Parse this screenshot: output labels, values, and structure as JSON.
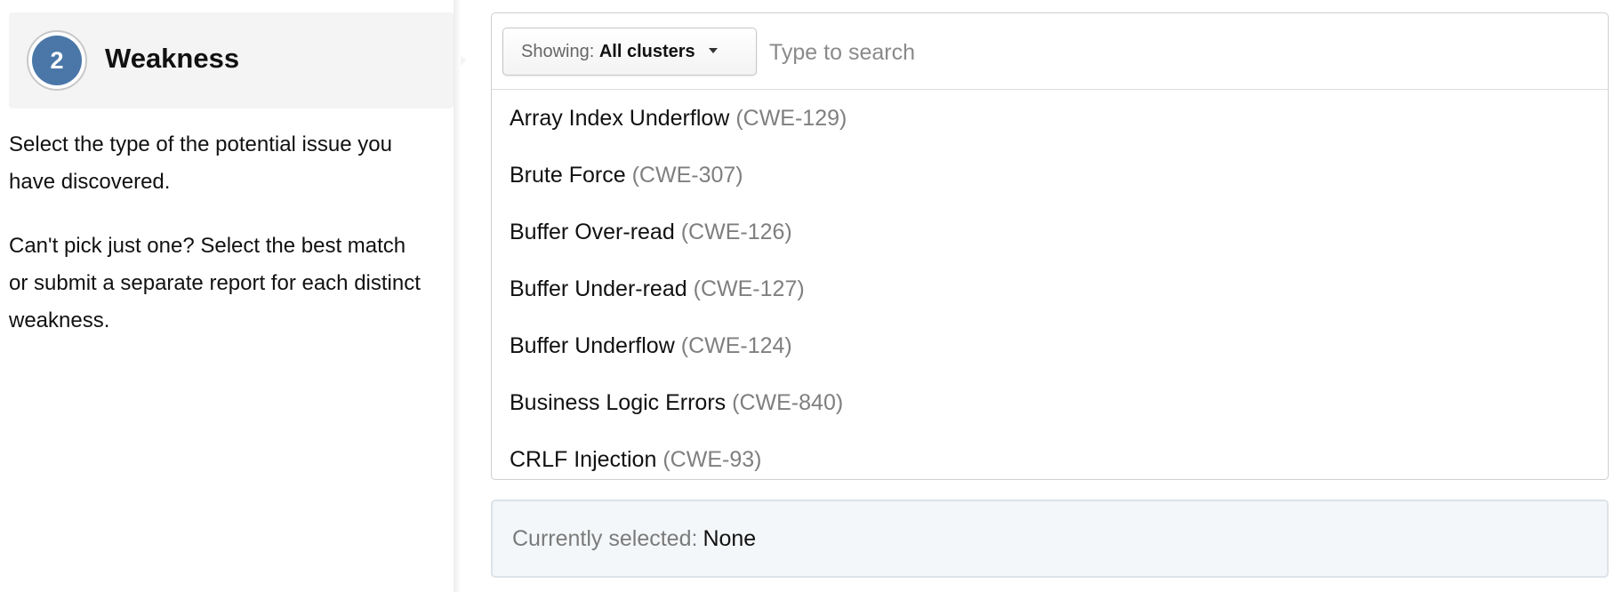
{
  "step": {
    "number": "2",
    "title": "Weakness",
    "description_1": "Select the type of the potential issue you have discovered.",
    "description_2": "Can't pick just one? Select the best match or submit a separate report for each distinct weakness."
  },
  "filter": {
    "prefix": "Showing:",
    "value": "All clusters",
    "icon": "caret-down-icon"
  },
  "search": {
    "placeholder": "Type to search",
    "value": ""
  },
  "weaknesses": [
    {
      "name": "Array Index Underflow",
      "code": "(CWE-129)"
    },
    {
      "name": "Brute Force",
      "code": "(CWE-307)"
    },
    {
      "name": "Buffer Over-read",
      "code": "(CWE-126)"
    },
    {
      "name": "Buffer Under-read",
      "code": "(CWE-127)"
    },
    {
      "name": "Buffer Underflow",
      "code": "(CWE-124)"
    },
    {
      "name": "Business Logic Errors",
      "code": "(CWE-840)"
    },
    {
      "name": "CRLF Injection",
      "code": "(CWE-93)"
    }
  ],
  "selection": {
    "label": "Currently selected:",
    "value": "None"
  },
  "colors": {
    "step_badge": "#4a77a8",
    "header_bg": "#f4f4f4",
    "selected_bg": "#f4f7f9",
    "muted_text": "#7f7f7f"
  }
}
